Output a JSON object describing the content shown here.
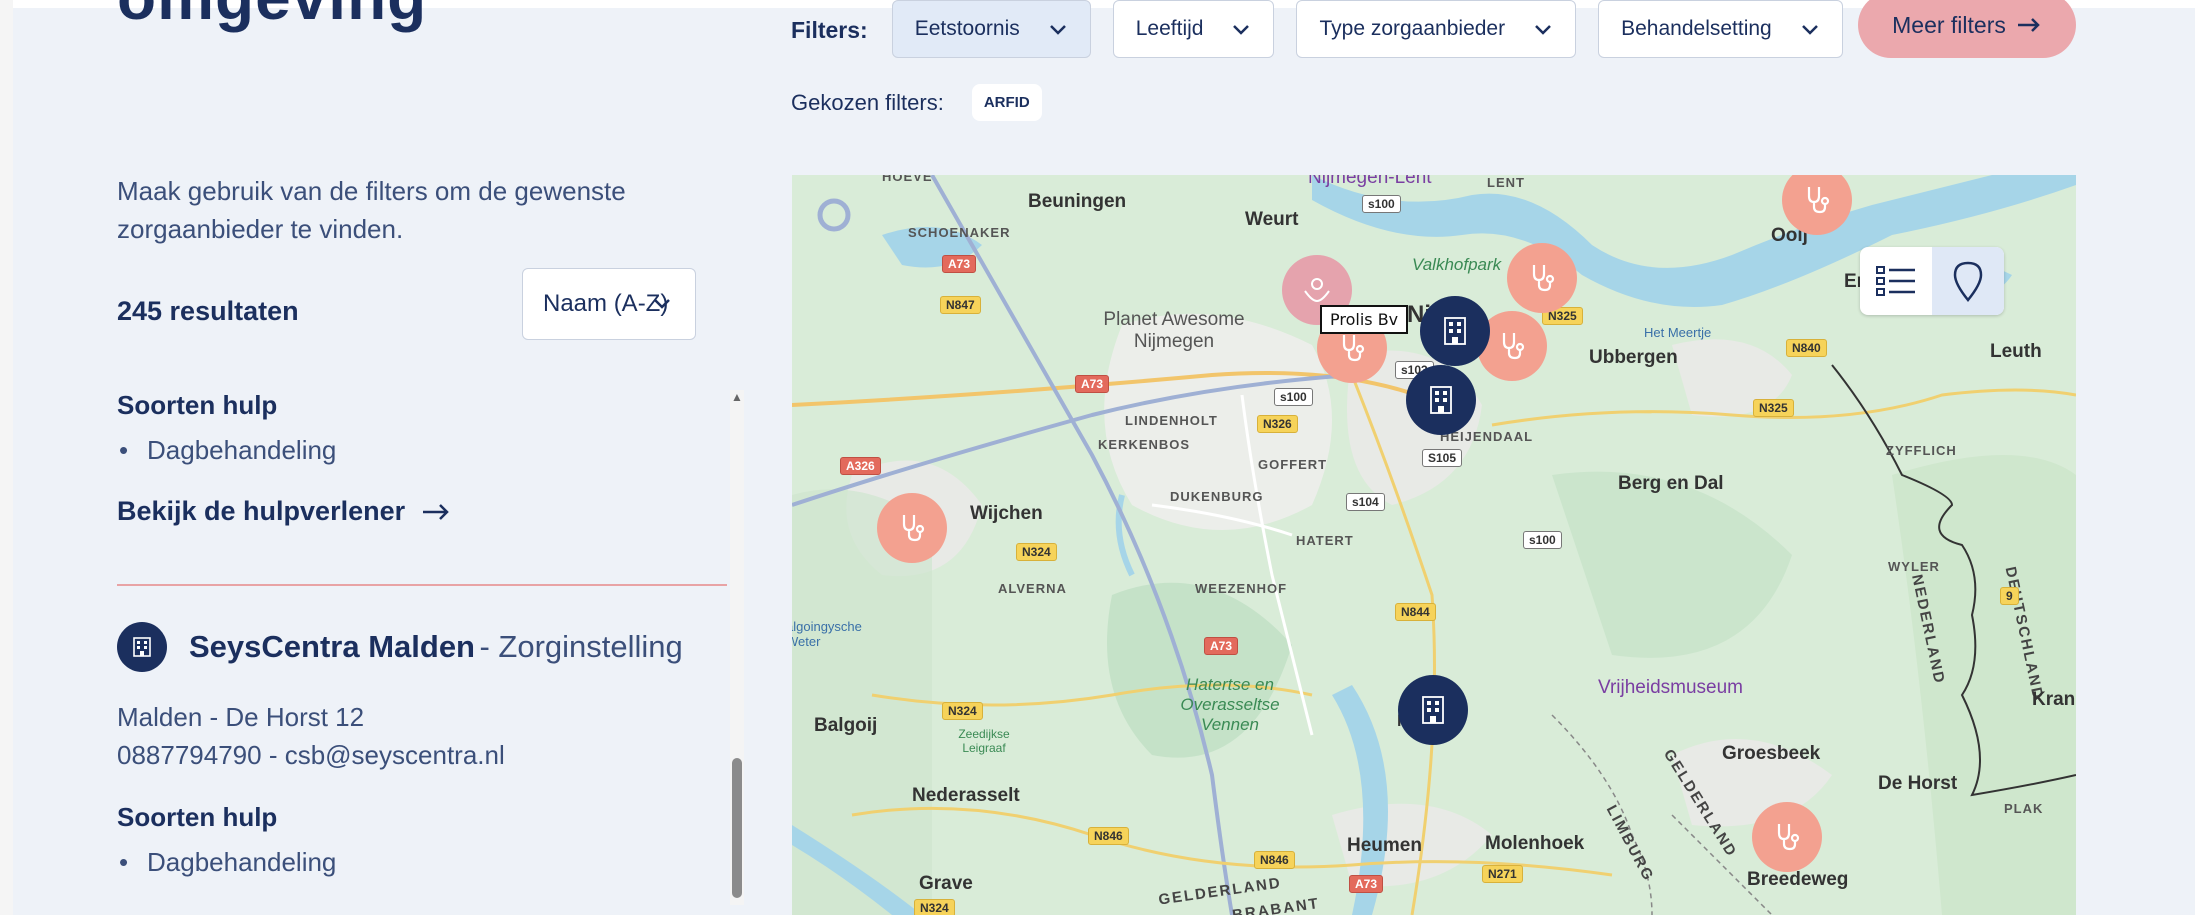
{
  "page": {
    "heading": "omgeving",
    "intro": "Maak gebruik van de filters om de gewenste zorgaanbieder te vinden.",
    "results_count": "245 resultaten",
    "sort": {
      "selected": "Naam (A-Z)"
    }
  },
  "filters": {
    "label": "Filters:",
    "buttons": [
      "Eetstoornis",
      "Leeftijd",
      "Type zorgaanbieder",
      "Behandelsetting"
    ],
    "more": "Meer filters",
    "chosen_label": "Gekozen filters:",
    "chosen": [
      "ARFID"
    ]
  },
  "results": [
    {
      "soorten_title": "Soorten hulp",
      "help": [
        "Dagbehandeling"
      ],
      "link": "Bekijk de hulpverlener"
    },
    {
      "name": "SeysCentra Malden",
      "type": "- Zorginstelling",
      "address": "Malden - De Horst 12",
      "contact": "0887794790 - csb@seyscentra.nl",
      "soorten_title": "Soorten hulp",
      "help": [
        "Dagbehandeling"
      ]
    }
  ],
  "map": {
    "tooltip": "Prolis Bv",
    "places": {
      "beuningen": "Beuningen",
      "weurt": "Weurt",
      "nijmegen_lent": "Nijmegen-Lent",
      "lent": "LENT",
      "hoeve": "HOEVE",
      "schoenaker": "SCHOENAKER",
      "valkhofpark": "Valkhofpark",
      "ooij": "Ooij",
      "er": "Er",
      "leuth": "Leuth",
      "planet": "Planet Awesome Nijmegen",
      "ni": "Ni",
      "ubbergen": "Ubbergen",
      "het_meertje": "Het Meertje",
      "lindenholt": "LINDENHOLT",
      "kerkenbos": "KERKENBOS",
      "goffert": "GOFFERT",
      "heijendaal": "HEIJENDAAL",
      "zyfflich": "ZYFFLICH",
      "dukenburg": "DUKENBURG",
      "berg_en_dal": "Berg en Dal",
      "wijchen": "Wijchen",
      "hatert": "HATERT",
      "alverna": "ALVERNA",
      "weezenhof": "WEEZENHOF",
      "wyler": "WYLER",
      "deutschland": "DEUTSCHLAND",
      "nederland": "NEDERLAND",
      "algoingysche": "algoingysche Weter",
      "hatertse": "Hatertse en Overasseltse Vennen",
      "vrijheidsmuseum": "Vrijheidsmuseum",
      "kran": "Kran",
      "balgoij": "Balgoij",
      "zeedijkse": "Zeedijkse Leigraaf",
      "groesbeek": "Groesbeek",
      "de_horst": "De Horst",
      "plak": "PLAK",
      "nederasselt": "Nederasselt",
      "gelderland": "GELDERLAND",
      "limburg": "LIMBURG",
      "heumen": "Heumen",
      "molenhoek": "Molenhoek",
      "grave": "Grave",
      "gelderland2": "GELDERLAND",
      "brabant": "BRABANT",
      "breedeweg": "Breedeweg",
      "m": "M"
    },
    "roads": {
      "a73a": "A73",
      "a73b": "A73",
      "a73c": "A73",
      "a73d": "A73",
      "a326": "A326",
      "n847": "N847",
      "n326": "N326",
      "n325a": "N325",
      "n325b": "N325",
      "n840": "N840",
      "n324a": "N324",
      "n324b": "N324",
      "n324c": "N324",
      "n844": "N844",
      "n846a": "N846",
      "n846b": "N846",
      "n271": "N271",
      "s100a": "s100",
      "s100b": "s100",
      "s100c": "s100",
      "s103": "s103",
      "s104": "s104",
      "s105": "S105",
      "nine": "9"
    }
  }
}
